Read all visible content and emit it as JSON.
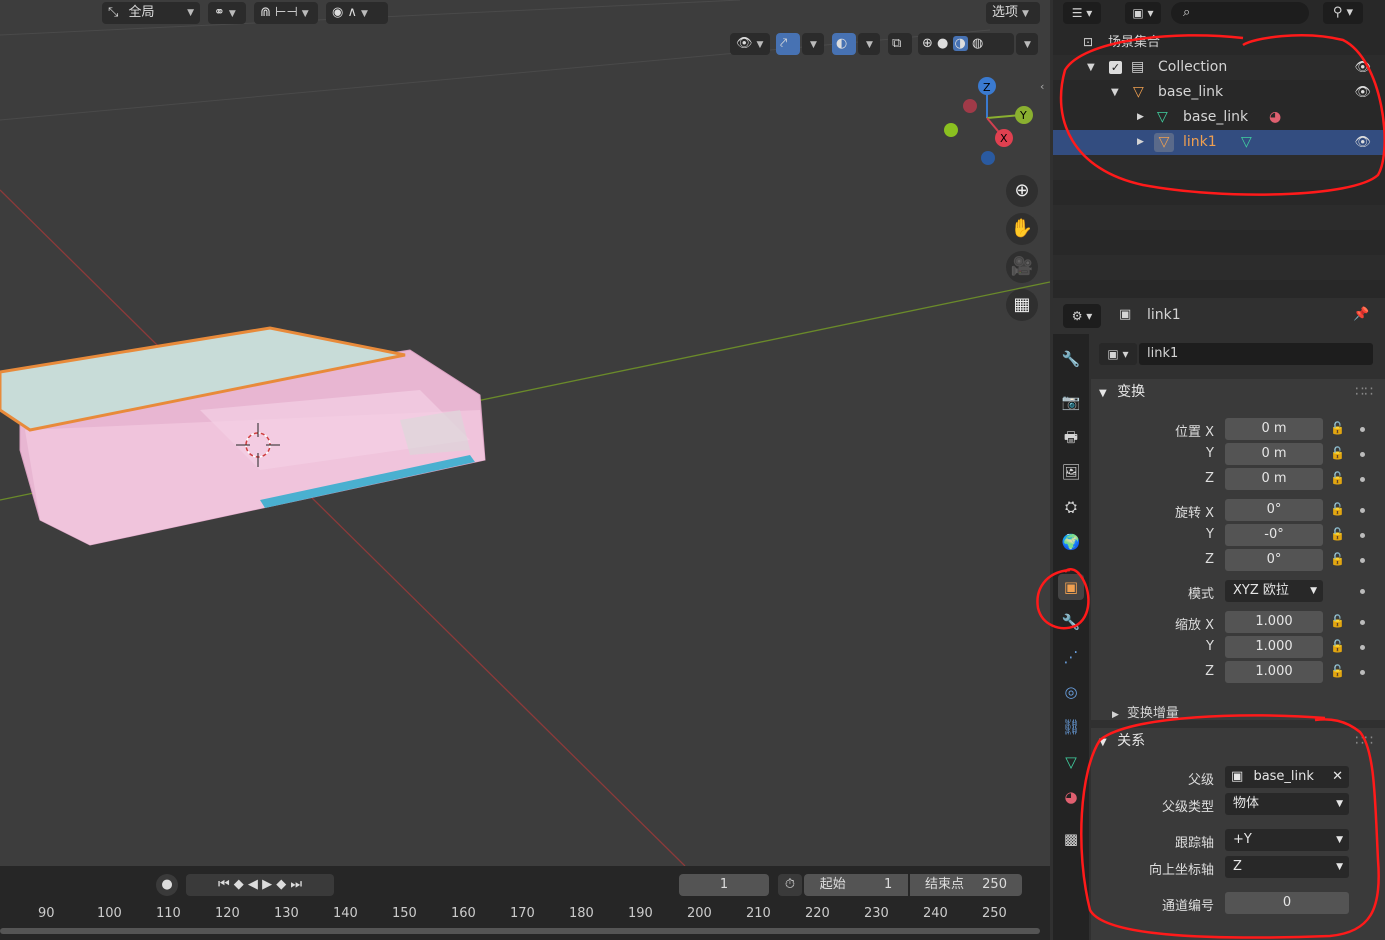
{
  "viewport": {
    "header": {
      "transform_orientation": "全局",
      "options_label": "选项"
    },
    "gizmo": {
      "z": "Z",
      "y": "Y",
      "x": "X"
    }
  },
  "timeline": {
    "current_frame": "1",
    "start_label": "起始",
    "start_value": "1",
    "end_label": "结束点",
    "end_value": "250",
    "ticks": [
      "90",
      "100",
      "110",
      "120",
      "130",
      "140",
      "150",
      "160",
      "170",
      "180",
      "190",
      "200",
      "210",
      "220",
      "230",
      "240",
      "250"
    ]
  },
  "outliner": {
    "root": "场景集合",
    "collection": "Collection",
    "object_parent": "base_link",
    "mesh_child": "base_link",
    "selected_object": "link1"
  },
  "properties": {
    "header_object": "link1",
    "name_field": "link1",
    "transform_title": "变换",
    "location_label": "位置 X",
    "location": [
      "0 m",
      "0 m",
      "0 m"
    ],
    "rotation_label": "旋转 X",
    "rotation": [
      "0°",
      "-0°",
      "0°"
    ],
    "mode_label": "模式",
    "mode_value": "XYZ 欧拉",
    "scale_label": "缩放 X",
    "scale": [
      "1.000",
      "1.000",
      "1.000"
    ],
    "axis_y": "Y",
    "axis_z": "Z",
    "delta_title": "变换增量",
    "relations_title": "关系",
    "parent_label": "父级",
    "parent_value": "base_link",
    "parent_type_label": "父级类型",
    "parent_type_value": "物体",
    "track_axis_label": "跟踪轴",
    "track_axis_value": "+Y",
    "up_axis_label": "向上坐标轴",
    "up_axis_value": "Z",
    "pass_index_label": "通道编号",
    "pass_index_value": "0"
  }
}
